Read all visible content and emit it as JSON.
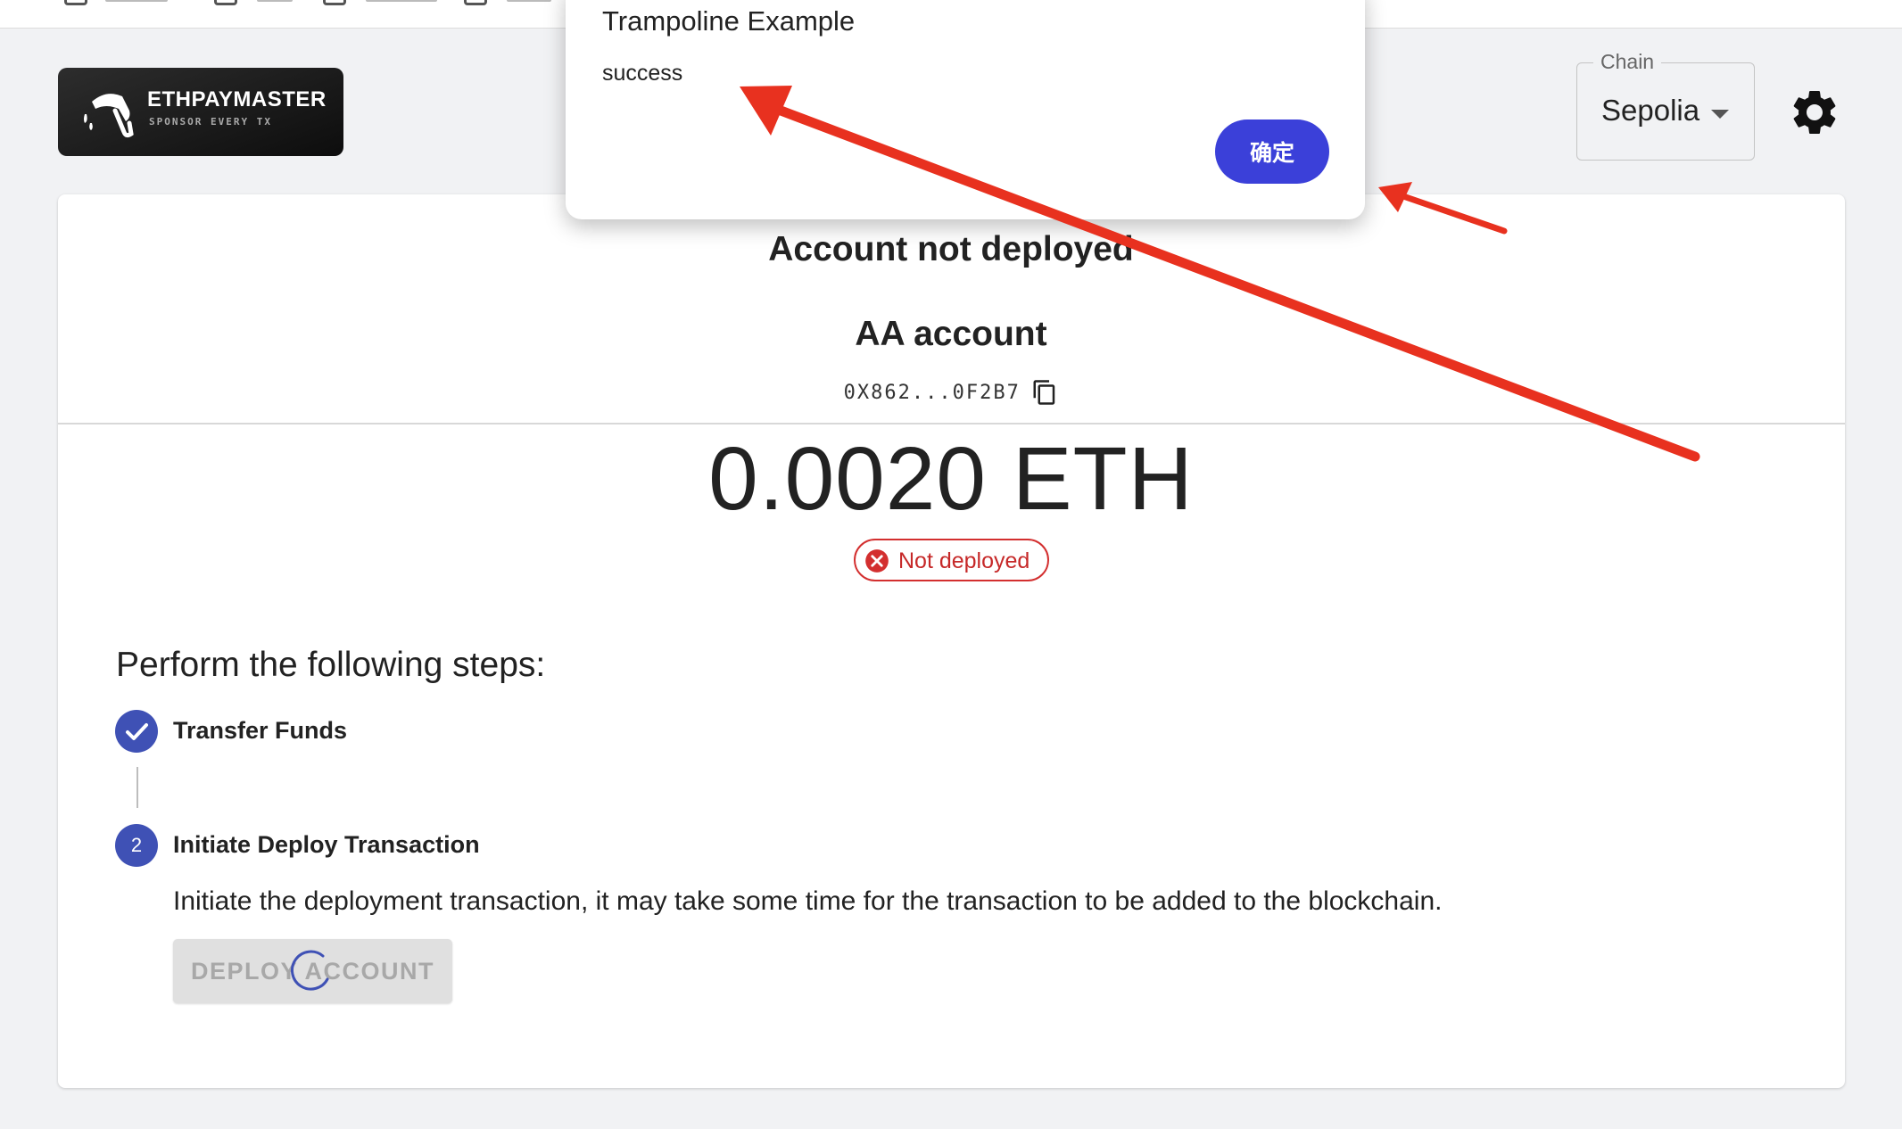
{
  "logo": {
    "title": "ETHPAYMASTER",
    "subtitle": "SPONSOR EVERY TX"
  },
  "chain": {
    "label": "Chain",
    "value": "Sepolia"
  },
  "account": {
    "status_title": "Account not deployed",
    "aa_title": "AA account",
    "address": "0X862...0F2B7",
    "balance": "0.0020 ETH",
    "badge": "Not deployed"
  },
  "steps": {
    "title": "Perform the following steps:",
    "items": [
      {
        "number": "",
        "label": "Transfer Funds",
        "state": "completed"
      },
      {
        "number": "2",
        "label": "Initiate Deploy Transaction",
        "state": "active"
      }
    ],
    "description": "Initiate the deployment transaction, it may take some time for the transaction to be added to the blockchain.",
    "deploy_button": "DEPLOY ACCOUNT"
  },
  "dialog": {
    "title": "Trampoline Example",
    "message": "success",
    "confirm_button": "确定"
  },
  "colors": {
    "primary": "#3f51b5",
    "dialog_button": "#3b40d9",
    "error": "#d32f2f",
    "annotation_arrow": "#e8311f"
  },
  "icons": [
    "gas-pump-icon",
    "caret-down-icon",
    "gear-icon",
    "copy-icon",
    "error-circle-icon",
    "check-icon",
    "spinner-icon"
  ]
}
